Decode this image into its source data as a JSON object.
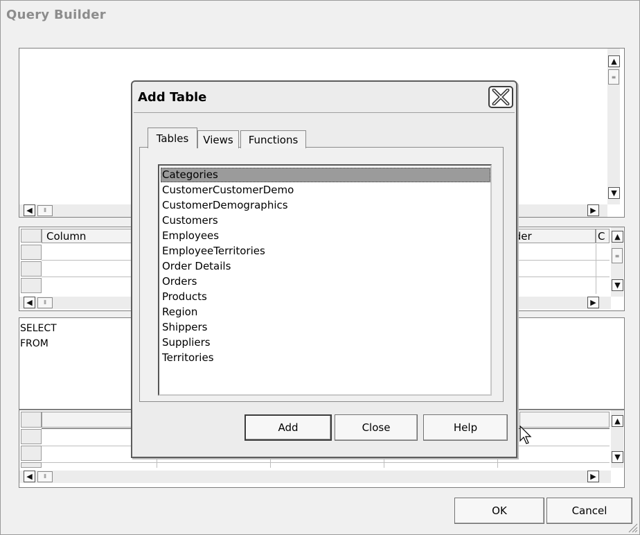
{
  "window": {
    "title": "Query Builder"
  },
  "grid": {
    "columns": [
      "Column",
      "Order",
      "C"
    ]
  },
  "sql": {
    "lines": [
      "SELECT",
      "FROM"
    ]
  },
  "footer": {
    "ok_label": "OK",
    "cancel_label": "Cancel"
  },
  "dialog": {
    "title": "Add Table",
    "tabs": [
      {
        "label": "Tables",
        "active": true
      },
      {
        "label": "Views",
        "active": false
      },
      {
        "label": "Functions",
        "active": false
      }
    ],
    "tables": [
      {
        "label": "Categories",
        "selected": true
      },
      {
        "label": "CustomerCustomerDemo",
        "selected": false
      },
      {
        "label": "CustomerDemographics",
        "selected": false
      },
      {
        "label": "Customers",
        "selected": false
      },
      {
        "label": "Employees",
        "selected": false
      },
      {
        "label": "EmployeeTerritories",
        "selected": false
      },
      {
        "label": "Order Details",
        "selected": false
      },
      {
        "label": "Orders",
        "selected": false
      },
      {
        "label": "Products",
        "selected": false
      },
      {
        "label": "Region",
        "selected": false
      },
      {
        "label": "Shippers",
        "selected": false
      },
      {
        "label": "Suppliers",
        "selected": false
      },
      {
        "label": "Territories",
        "selected": false
      }
    ],
    "buttons": {
      "add_label": "Add",
      "close_label": "Close",
      "help_label": "Help"
    }
  },
  "icons": {
    "close": "close-x-icon",
    "arrow_up": "chevron-up-icon",
    "arrow_down": "chevron-down-icon",
    "arrow_left": "chevron-left-icon",
    "arrow_right": "chevron-right-icon",
    "grip": "scroll-grip-icon",
    "cursor": "mouse-pointer-icon",
    "resize": "resize-grip-icon"
  },
  "colors": {
    "selection": "#9b9b9b",
    "title_text": "#8c8c8c",
    "window_bg": "#f0f0f0"
  }
}
